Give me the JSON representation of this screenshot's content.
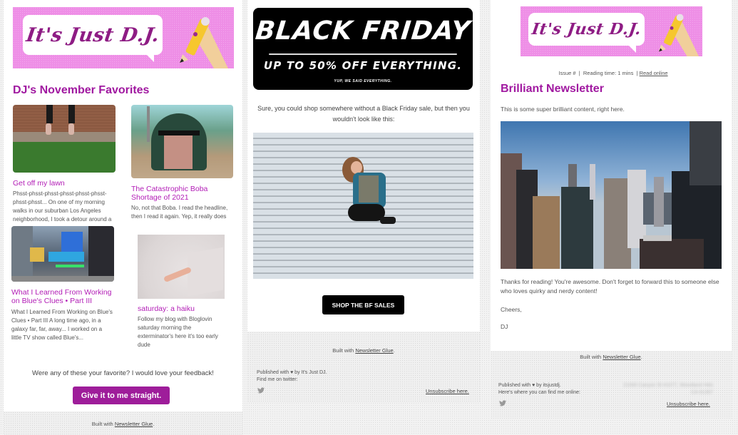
{
  "newsletter_1": {
    "banner_text": "It's Just D.J.",
    "heading": "DJ's November Favorites",
    "posts": [
      {
        "title": "Get off my lawn",
        "excerpt": "Phsst-phsst-phsst-phsst-phsst-phsst-phsst-phsst... On one of my morning walks in our suburban Los Angeles neighborhood, I took a detour around a"
      },
      {
        "title": "The Catastrophic Boba Shortage of 2021",
        "excerpt": "No, not that Boba. I read the headline, then I read it again. Yep, it really does say"
      },
      {
        "title": "What I Learned From Working on Blue's Clues • Part III",
        "excerpt": "What I Learned From Working on Blue's Clues • Part III A long time ago, in a galaxy far, far, away... I worked on a little TV show called Blue's..."
      },
      {
        "title": "saturday: a haiku",
        "excerpt": "Follow my blog with Bloglovin saturday morning the exterminator's here it's too early dude"
      }
    ],
    "feedback_prompt": "Were any of these your favorite? I would love your feedback!",
    "cta_label": "Give it to me straight.",
    "built_with_prefix": "Built with ",
    "built_with_link": "Newsletter Glue",
    "built_with_suffix": "."
  },
  "newsletter_2": {
    "banner_title": "BLACK FRIDAY",
    "banner_subtitle": "UP TO 50% OFF EVERYTHING.",
    "banner_tagline": "YUP, WE SAID EVERYTHING.",
    "intro": "Sure, you could shop somewhere without a Black Friday sale, but then you wouldn't look like this:",
    "cta_label": "SHOP THE BF SALES",
    "built_with_prefix": "Built with ",
    "built_with_link": "Newsletter Glue",
    "built_with_suffix": ".",
    "published_line": "Published with ♥ by It's Just DJ.",
    "find_me_line": "Find me on twitter:",
    "unsubscribe_label": "Unsubscribe here."
  },
  "newsletter_3": {
    "banner_text": "It's Just D.J.",
    "meta_issue": "Issue #",
    "meta_sep": "|",
    "meta_reading_time": "Reading time:  1 mins",
    "meta_read_online": "Read online",
    "heading": "Brilliant Newsletter",
    "intro": "This is some super brilliant content, right here.",
    "thanks": "Thanks for reading! You're awesome. Don't forget to forward this to someone else who loves quirky and nerdy content!",
    "signoff": "Cheers,",
    "signature": "DJ",
    "built_with_prefix": "Built with ",
    "built_with_link": "Newsletter Glue",
    "built_with_suffix": ".",
    "published_line": "Published with ♥ by itsjustdj.",
    "find_me_line": "Here's where you can find me online:",
    "address_blurred_1": "21000 Canyon St #1077, Woodland Hills",
    "address_blurred_2": "CA 91367",
    "unsubscribe_label": "Unsubscribe here."
  },
  "colors": {
    "brand_purple": "#a018a0",
    "button_purple": "#9e1d9a",
    "banner_pink": "#ee8ee6",
    "black": "#000000"
  },
  "icons": {
    "twitter": "twitter-icon",
    "heart": "heart-icon"
  }
}
